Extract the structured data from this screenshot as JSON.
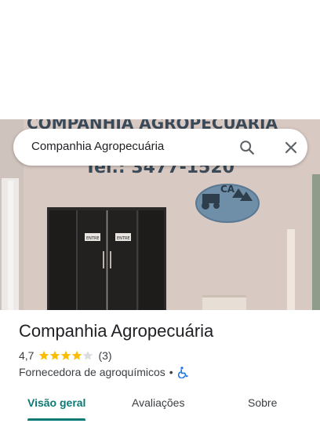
{
  "search": {
    "query": "Companhia Agropecuária",
    "search_icon": "search-icon",
    "close_icon": "close-icon"
  },
  "photo": {
    "sign_top": "COMPANHIA AGROPECUÁRIA",
    "sign_bottom": "Tel.: 3477-1520",
    "logo_text": "CA",
    "door_label_left": "ENTRE",
    "door_label_right": "ENTRE"
  },
  "place": {
    "title": "Companhia Agropecuária",
    "rating": "4,7",
    "rating_stars": 4.7,
    "review_count": "(3)",
    "category": "Fornecedora de agroquímicos",
    "separator": "•",
    "accessibility_icon": "wheelchair-icon"
  },
  "tabs": [
    {
      "label": "Visão geral",
      "active": true
    },
    {
      "label": "Avaliações",
      "active": false
    },
    {
      "label": "Sobre",
      "active": false
    }
  ],
  "colors": {
    "accent": "#0b7a75",
    "star": "#fbbc04",
    "text_primary": "#202124",
    "text_secondary": "#3c4043",
    "accessibility": "#1a73e8"
  }
}
